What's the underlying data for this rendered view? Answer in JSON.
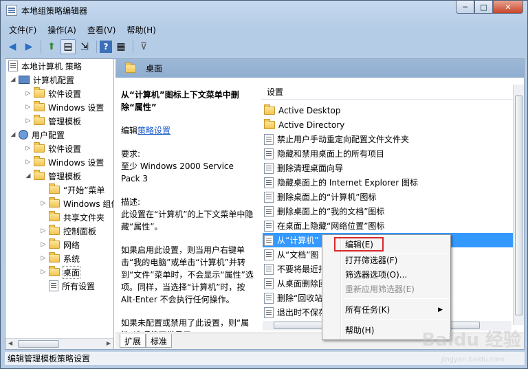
{
  "window": {
    "title": "本地组策略编辑器",
    "btn_min": "─",
    "btn_max": "□",
    "btn_close": "✕"
  },
  "menu": [
    "文件(F)",
    "操作(A)",
    "查看(V)",
    "帮助(H)"
  ],
  "toolbar": {
    "back": "◀",
    "forward": "▶",
    "up": "⬆",
    "show_tree": "▤",
    "export": "⇲",
    "help": "?",
    "properties": "▦",
    "filter": "⊽"
  },
  "tree": {
    "root": "本地计算机 策略",
    "computer": "计算机配置",
    "c_software": "软件设置",
    "c_windows": "Windows 设置",
    "c_templates": "管理模板",
    "user": "用户配置",
    "u_software": "软件设置",
    "u_windows": "Windows 设置",
    "u_templates": "管理模板",
    "start": "“开始”菜单",
    "wincomp": "Windows 组件",
    "shared": "共享文件夹",
    "control": "控制面板",
    "network": "网络",
    "system": "系统",
    "desktop": "桌面",
    "all": "所有设置"
  },
  "header": {
    "title": "桌面"
  },
  "description": {
    "title": "从“计算机”图标上下文菜单中删除“属性”",
    "edit_prefix": "编辑",
    "edit_link": "策略设置",
    "req_label": "要求:",
    "req_value": "至少 Windows 2000 Service Pack 3",
    "desc_label": "描述:",
    "desc_text": "此设置在“计算机”的上下文菜单中隐藏“属性”。",
    "enabled_text": "如果启用此设置，则当用户右键单击“我的电脑”或单击“计算机”并转到“文件”菜单时，不会显示“属性”选项。同样，当选择“计算机”时，按 Alt-Enter 不会执行任何操作。",
    "disabled_text": "如果未配置或禁用了此设置，则“属性”选项将正常显示。"
  },
  "list": {
    "column": "设置",
    "items": [
      "Active Desktop",
      "Active Directory",
      "禁止用户手动重定向配置文件文件夹",
      "隐藏和禁用桌面上的所有项目",
      "删除清理桌面向导",
      "隐藏桌面上的 Internet Explorer 图标",
      "删除桌面上的“计算机”图标",
      "删除桌面上的“我的文档”图标",
      "在桌面上隐藏“网络位置”图标",
      "从“计算机”",
      "从“文档”图",
      "不要将最近打",
      "从桌面删除回",
      "删除“回收站",
      "退出时不保存"
    ]
  },
  "tabs": [
    "扩展",
    "标准"
  ],
  "context_menu": {
    "edit": "编辑(E)",
    "open_filter": "打开筛选器(F)",
    "filter_options": "筛选器选项(O)...",
    "reapply": "重新应用筛选器(E)",
    "all_tasks": "所有任务(K)",
    "help": "帮助(H)"
  },
  "status": "编辑管理模板策略设置",
  "watermark": {
    "main": "Baidu 经验",
    "sub": "jingyan.baidu.com"
  },
  "colors": {
    "selection": "#3399ff",
    "highlight_box": "#d9262a",
    "header": "#9db8d6",
    "link": "#1a5bc9"
  }
}
